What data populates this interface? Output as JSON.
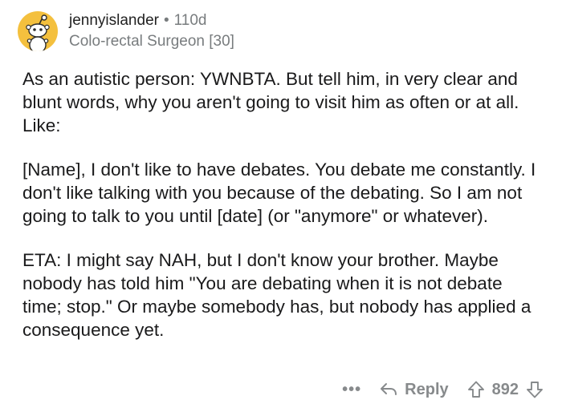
{
  "comment": {
    "author": "jennyislander",
    "separator": "•",
    "age": "110d",
    "flair": "Colo-rectal Surgeon [30]",
    "paragraphs": [
      "As an autistic person: YWNBTA.  But tell him, in very clear and blunt words, why you aren't going to visit him as often or at all.  Like:",
      "[Name], I don't like to have debates.  You debate me constantly.  I don't like talking with you because of the debating.  So I am not going to talk to you until [date] (or \"anymore\" or whatever).",
      "ETA: I might say NAH, but I don't know your brother.  Maybe nobody has told him \"You are debating when it is not debate time; stop.\"  Or maybe somebody has, but nobody has applied a consequence yet."
    ]
  },
  "actions": {
    "more_label": "•••",
    "reply_label": "Reply",
    "score": "892"
  },
  "icons": {
    "avatar": "snoo-avatar-icon",
    "reply": "reply-arrow-icon",
    "upvote": "upvote-arrow-icon",
    "downvote": "downvote-arrow-icon"
  },
  "colors": {
    "avatar_bg": "#f4c03e",
    "meta_gray": "#787c7e",
    "action_gray": "#878a8c",
    "text": "#1a1a1b"
  }
}
